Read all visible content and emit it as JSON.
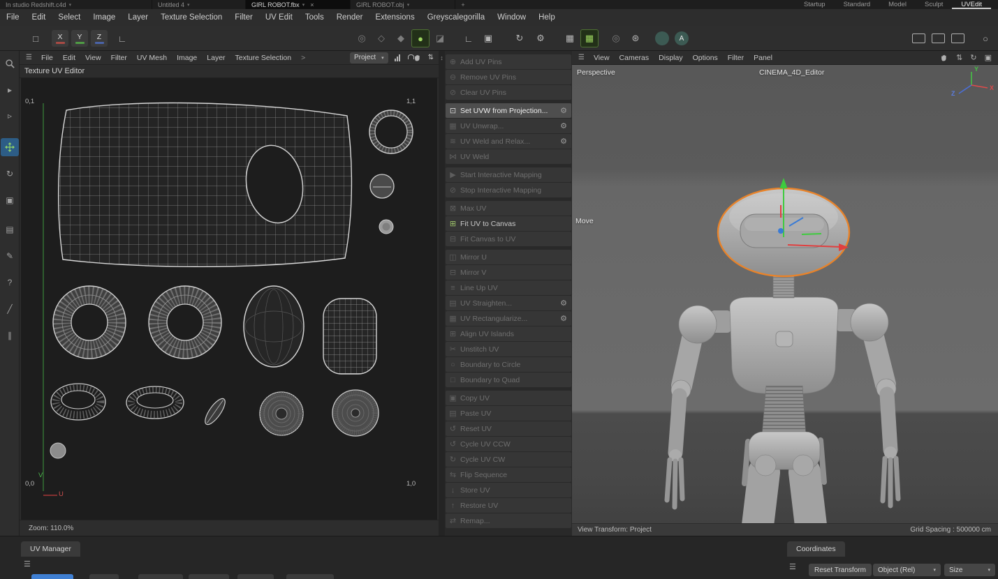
{
  "colors": {
    "selection_orange": "#e8832a",
    "axis_x_red": "#d84a4a",
    "axis_y_green": "#49b849",
    "axis_z_blue": "#4b6fd8",
    "active_tool_green": "#9cd45f",
    "active_tool_blue": "#2d5d86"
  },
  "glyphs": {
    "hamburger": "☰",
    "caret_down": "▾",
    "close": "×",
    "add": "+",
    "gear": "⚙",
    "splitter": "↕",
    "updown": "⇅"
  },
  "icons": {
    "window": "□",
    "workplane": "∟",
    "mode_a": "◎",
    "mode_b": "◇",
    "mode_c": "◆",
    "mode_d": "●",
    "mode_e": "◪",
    "axis_corner": "∟",
    "axis_box": "▣",
    "rotate": "↻",
    "grid": "▦",
    "rings": "◎",
    "ring_gear": "⊛",
    "annotation_letter": "A",
    "circle": "○",
    "select_a": "▸",
    "select_b": "▹",
    "frame": "▣",
    "region": "▤",
    "brush": "✎",
    "help": "?",
    "knife": "╱",
    "parallel": "∥"
  },
  "doc_bar": {
    "tabs": [
      {
        "label": "In studio Redshift.c4d"
      },
      {
        "label": "Untitled 4"
      },
      {
        "label": "GIRL ROBOT.fbx"
      },
      {
        "label": "GIRL ROBOT.obj"
      }
    ],
    "layouts": [
      "Startup",
      "Standard",
      "Model",
      "Sculpt",
      "UVEdit"
    ]
  },
  "menubar": [
    "File",
    "Edit",
    "Select",
    "Image",
    "Layer",
    "Texture Selection",
    "Filter",
    "UV Edit",
    "Tools",
    "Render",
    "Extensions",
    "Greyscalegorilla",
    "Window",
    "Help"
  ],
  "toolbar": {
    "axis_x": "X",
    "axis_y": "Y",
    "axis_z": "Z"
  },
  "uv_editor": {
    "menu": [
      "File",
      "Edit",
      "View",
      "Filter",
      "UV Mesh",
      "Image",
      "Layer",
      "Texture Selection"
    ],
    "menu_overflow": ">",
    "texture_dropdown": "Project",
    "title": "Texture UV Editor",
    "corner_tl": "0,1",
    "corner_tr": "1,1",
    "corner_bl": "0,0",
    "corner_br": "1,0",
    "axis_u": "U",
    "axis_v": "V",
    "zoom": "Zoom: 110.0%"
  },
  "uv_commands": {
    "groups": [
      {
        "items": [
          {
            "label": "Add UV Pins",
            "icon": "pin-add-icon",
            "glyph": "⊕",
            "state": "disabled"
          },
          {
            "label": "Remove UV Pins",
            "icon": "pin-remove-icon",
            "glyph": "⊖",
            "state": "disabled"
          },
          {
            "label": "Clear UV Pins",
            "icon": "pin-clear-icon",
            "glyph": "⊘",
            "state": "disabled"
          }
        ]
      },
      {
        "items": [
          {
            "label": "Set UVW from Projection...",
            "icon": "projection-icon",
            "glyph": "⊡",
            "state": "highlighted",
            "gear": true
          },
          {
            "label": "UV Unwrap...",
            "icon": "unwrap-icon",
            "glyph": "▦",
            "state": "disabled",
            "gear": true
          },
          {
            "label": "UV Weld and Relax...",
            "icon": "weld-relax-icon",
            "glyph": "≋",
            "state": "disabled",
            "gear": true
          },
          {
            "label": "UV Weld",
            "icon": "weld-icon",
            "glyph": "⋈",
            "state": "disabled"
          }
        ]
      },
      {
        "items": [
          {
            "label": "Start Interactive Mapping",
            "icon": "start-mapping-icon",
            "glyph": "▶",
            "state": "disabled"
          },
          {
            "label": "Stop Interactive Mapping",
            "icon": "stop-mapping-icon",
            "glyph": "⊘",
            "state": "disabled"
          }
        ]
      },
      {
        "items": [
          {
            "label": "Max UV",
            "icon": "max-uv-icon",
            "glyph": "⊠",
            "state": "disabled"
          },
          {
            "label": "Fit UV to Canvas",
            "icon": "fit-uv-to-canvas-icon",
            "glyph": "⊞",
            "state": "enabled"
          },
          {
            "label": "Fit Canvas to UV",
            "icon": "fit-canvas-to-uv-icon",
            "glyph": "⊟",
            "state": "disabled"
          }
        ]
      },
      {
        "items": [
          {
            "label": "Mirror U",
            "icon": "mirror-u-icon",
            "glyph": "◫",
            "state": "disabled"
          },
          {
            "label": "Mirror V",
            "icon": "mirror-v-icon",
            "glyph": "⊟",
            "state": "disabled"
          },
          {
            "label": "Line Up UV",
            "icon": "line-up-uv-icon",
            "glyph": "≡",
            "state": "disabled"
          },
          {
            "label": "UV Straighten...",
            "icon": "uv-straighten-icon",
            "glyph": "▤",
            "state": "disabled",
            "gear": true
          },
          {
            "label": "UV Rectangularize...",
            "icon": "uv-rectangularize-icon",
            "glyph": "▦",
            "state": "disabled",
            "gear": true
          },
          {
            "label": "Align UV Islands",
            "icon": "align-uv-islands-icon",
            "glyph": "⊞",
            "state": "disabled"
          },
          {
            "label": "Unstitch UV",
            "icon": "unstitch-uv-icon",
            "glyph": "✂",
            "state": "disabled"
          },
          {
            "label": "Boundary to Circle",
            "icon": "boundary-to-circle-icon",
            "glyph": "○",
            "state": "disabled"
          },
          {
            "label": "Boundary to Quad",
            "icon": "boundary-to-quad-icon",
            "glyph": "□",
            "state": "disabled"
          }
        ]
      },
      {
        "items": [
          {
            "label": "Copy UV",
            "icon": "copy-uv-icon",
            "glyph": "▣",
            "state": "disabled"
          },
          {
            "label": "Paste UV",
            "icon": "paste-uv-icon",
            "glyph": "▤",
            "state": "disabled"
          },
          {
            "label": "Reset UV",
            "icon": "reset-uv-icon",
            "glyph": "↺",
            "state": "disabled"
          },
          {
            "label": "Cycle UV CCW",
            "icon": "cycle-uv-ccw-icon",
            "glyph": "↺",
            "state": "disabled"
          },
          {
            "label": "Cycle UV CW",
            "icon": "cycle-uv-cw-icon",
            "glyph": "↻",
            "state": "disabled"
          },
          {
            "label": "Flip Sequence",
            "icon": "flip-sequence-icon",
            "glyph": "⇆",
            "state": "disabled"
          },
          {
            "label": "Store UV",
            "icon": "store-uv-icon",
            "glyph": "↓",
            "state": "disabled"
          },
          {
            "label": "Restore UV",
            "icon": "restore-uv-icon",
            "glyph": "↑",
            "state": "disabled"
          },
          {
            "label": "Remap...",
            "icon": "remap-icon",
            "glyph": "⇄",
            "state": "disabled"
          }
        ]
      }
    ]
  },
  "viewport": {
    "menu": [
      "View",
      "Cameras",
      "Display",
      "Options",
      "Filter",
      "Panel"
    ],
    "camera": "Perspective",
    "editor": "CINEMA_4D_Editor",
    "tool_hint": "Move",
    "axis_x": "X",
    "axis_y": "Y",
    "axis_z": "Z",
    "status_left": "View Transform: Project",
    "status_right": "Grid Spacing : 500000 cm"
  },
  "bottom": {
    "uv_manager_tab": "UV Manager",
    "coordinates_tab": "Coordinates",
    "reset_transform": "Reset Transform",
    "object_dropdown": "Object (Rel)",
    "size_dropdown": "Size"
  }
}
